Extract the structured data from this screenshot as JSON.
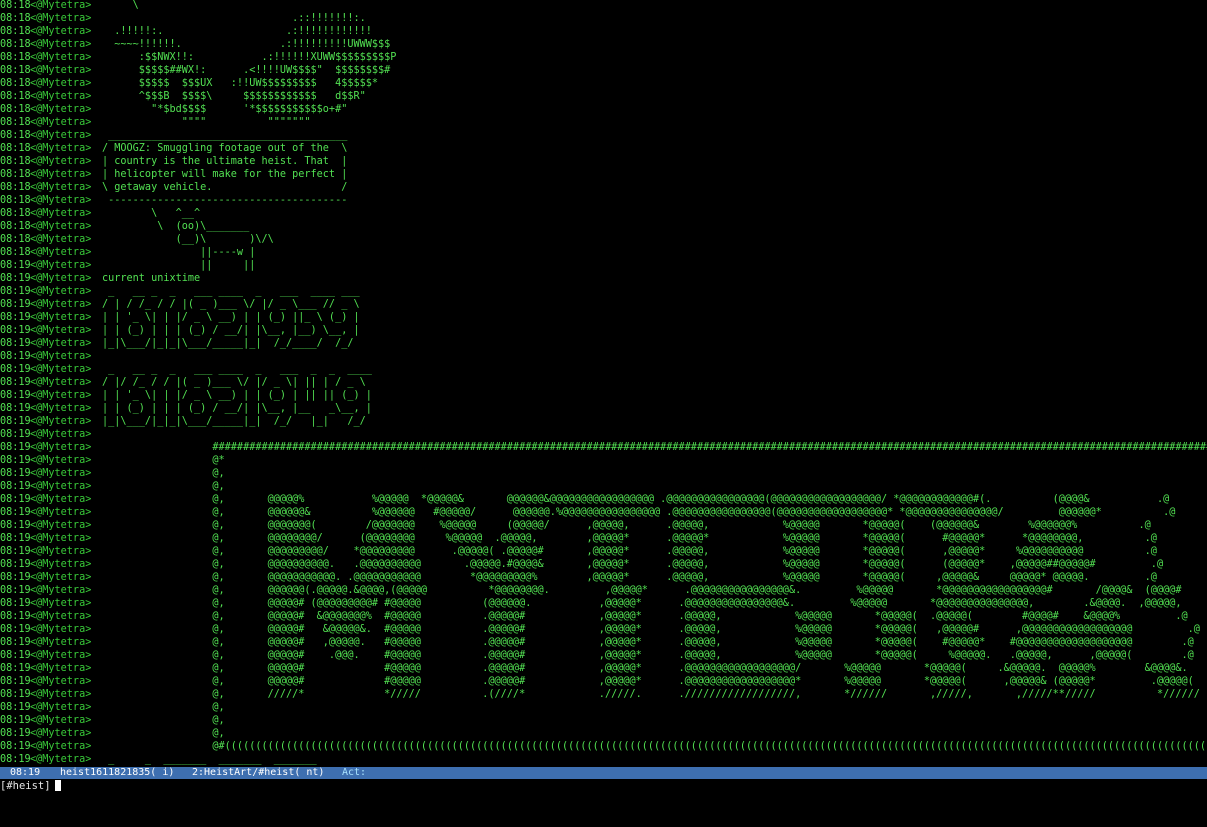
{
  "channel_log": {
    "nick": "<@Mytetra>",
    "lines": [
      {
        "time": "08:18",
        "text": "     \\"
      },
      {
        "time": "08:18",
        "text": "                               .::!!!!!!!:."
      },
      {
        "time": "08:18",
        "text": "  .!!!!!:.                    .:!!!!!!!!!!!!"
      },
      {
        "time": "08:18",
        "text": "  ~~~~!!!!!!.                .:!!!!!!!!!UWWW$$$"
      },
      {
        "time": "08:18",
        "text": "      :$$NWX!!:           .:!!!!!!XUWW$$$$$$$$$P"
      },
      {
        "time": "08:18",
        "text": "      $$$$$##WX!:      .<!!!!UW$$$$\"  $$$$$$$$#"
      },
      {
        "time": "08:18",
        "text": "      $$$$$  $$$UX   :!!UW$$$$$$$$$   4$$$$$*"
      },
      {
        "time": "08:18",
        "text": "      ^$$$B  $$$$\\     $$$$$$$$$$$$   d$$R\""
      },
      {
        "time": "08:18",
        "text": "        \"*$bd$$$$      '*$$$$$$$$$$$o+#\""
      },
      {
        "time": "08:18",
        "text": "             \"\"\"\"          \"\"\"\"\"\"\""
      },
      {
        "time": "08:18",
        "text": " _______________________________________"
      },
      {
        "time": "08:18",
        "text": "/ MOOGZ: Smuggling footage out of the  \\"
      },
      {
        "time": "08:18",
        "text": "| country is the ultimate heist. That  |"
      },
      {
        "time": "08:18",
        "text": "| helicopter will make for the perfect |"
      },
      {
        "time": "08:18",
        "text": "\\ getaway vehicle.                     /"
      },
      {
        "time": "08:18",
        "text": " ---------------------------------------"
      },
      {
        "time": "08:18",
        "text": "        \\   ^__^"
      },
      {
        "time": "08:18",
        "text": "         \\  (oo)\\_______"
      },
      {
        "time": "08:18",
        "text": "            (__)\\       )\\/\\"
      },
      {
        "time": "08:18",
        "text": "                ||----w |"
      },
      {
        "time": "08:19",
        "text": "                ||     ||"
      },
      {
        "time": "08:19",
        "text": "current unixtime"
      },
      {
        "time": "08:19",
        "text": " _   __ _  _   ___ ____  _   ___  ____ ___"
      },
      {
        "time": "08:19",
        "text": "/ | / /_ / / |( _ )___ \\/ |/ _ \\___ // _ \\"
      },
      {
        "time": "08:19",
        "text": "| | '_ \\| | |/ _ \\ __) | | (_) ||_ \\ (_) |"
      },
      {
        "time": "08:19",
        "text": "| | (_) | | | (_) / __/| |\\__, |__) \\__, |"
      },
      {
        "time": "08:19",
        "text": "|_|\\___/|_|_|\\___/_____|_|  /_/____/  /_/"
      },
      {
        "time": "08:19",
        "text": ""
      },
      {
        "time": "08:19",
        "text": " _   __ _  _   ___ ____  _   ___  _  _  ____"
      },
      {
        "time": "08:19",
        "text": "/ |/ /_ / / |( _ )___ \\/ |/ _ \\| || | / _ \\"
      },
      {
        "time": "08:19",
        "text": "| | '_ \\| | |/ _ \\ __) | | (_) | || || (_) |"
      },
      {
        "time": "08:19",
        "text": "| | (_) | | | (_) / __/| |\\__, |__   _\\__, |"
      },
      {
        "time": "08:19",
        "text": "|_|\\___/|_|_|\\___/_____|_|  /_/   |_|   /_/"
      },
      {
        "time": "08:19",
        "text": ""
      },
      {
        "time": "08:19",
        "text": "                  ##########################################################################################################################################################################"
      },
      {
        "time": "08:19",
        "text": "                  @*                                                                                                                                                                      .@"
      },
      {
        "time": "08:19",
        "text": "                  @,                                                                                                                                                                      .@"
      },
      {
        "time": "08:19",
        "text": "                  @,                                                                                                                                                                      .@"
      },
      {
        "time": "08:19",
        "text": "                  @,       @@@@@%           %@@@@@  *@@@@@&       @@@@@@&@@@@@@@@@@@@@@@@@ .@@@@@@@@@@@@@@@@(@@@@@@@@@@@@@@@@@@/ *@@@@@@@@@@@@#(.          (@@@@&           .@"
      },
      {
        "time": "08:19",
        "text": "                  @,       @@@@@@&          %@@@@@@   #@@@@@/      @@@@@@.%@@@@@@@@@@@@@@@@ .@@@@@@@@@@@@@@@@(@@@@@@@@@@@@@@@@@@* *@@@@@@@@@@@@@@@/         @@@@@@*          .@"
      },
      {
        "time": "08:19",
        "text": "                  @,       @@@@@@@(        /@@@@@@@    %@@@@@     (@@@@@/      ,@@@@@,      .@@@@@,            %@@@@@       *@@@@@(    (@@@@@@&        %@@@@@@%          .@"
      },
      {
        "time": "08:19",
        "text": "                  @,       @@@@@@@@/      (@@@@@@@@     %@@@@@  .@@@@@,        ,@@@@@*      .@@@@@*            %@@@@@       *@@@@@(      #@@@@@*      *@@@@@@@@,          .@"
      },
      {
        "time": "08:19",
        "text": "                  @,       @@@@@@@@@/    *@@@@@@@@@      .@@@@@( .@@@@@#       ,@@@@@*      .@@@@@,            %@@@@@       *@@@@@(      ,@@@@@*     %@@@@@@@@@@          .@"
      },
      {
        "time": "08:19",
        "text": "                  @,       @@@@@@@@@@.   .@@@@@@@@@@       .@@@@@.#@@@@&       ,@@@@@*      .@@@@@,            %@@@@@       *@@@@@(      (@@@@@*    ,@@@@@##@@@@@#         .@"
      },
      {
        "time": "08:19",
        "text": "                  @,       @@@@@@@@@@@. .@@@@@@@@@@@        *@@@@@@@@@%        ,@@@@@*      .@@@@@,            %@@@@@       *@@@@@(     ,@@@@@&     @@@@@* @@@@@.         .@"
      },
      {
        "time": "08:19",
        "text": "                  @,       @@@@@@(.@@@@@.&@@@@,(@@@@@          *@@@@@@@@.         ,@@@@@*      .@@@@@@@@@@@@@@@@&.         %@@@@@       *@@@@@@@@@@@@@@@@@#       /@@@@&  (@@@@#         .@"
      },
      {
        "time": "08:19",
        "text": "                  @,       @@@@@# (@@@@@@@@@# #@@@@@          (@@@@@@.           ,@@@@@*      .@@@@@@@@@@@@@@@@&.         %@@@@@       *@@@@@@@@@@@@@@@,        .&@@@@.  ,@@@@@,         .@"
      },
      {
        "time": "08:19",
        "text": "                  @,       @@@@@#  &@@@@@@@%  #@@@@@          .@@@@@#            ,@@@@@*      .@@@@@,            %@@@@@       *@@@@@(  .@@@@@(        #@@@@#    &@@@@%         .@"
      },
      {
        "time": "08:19",
        "text": "                  @,       @@@@@#   &@@@@@&.  #@@@@@          .@@@@@#            ,@@@@@*      .@@@@@,            %@@@@@       *@@@@@(   ,@@@@@#      ,@@@@@@@@@@@@@@@@@@         .@"
      },
      {
        "time": "08:19",
        "text": "                  @,       @@@@@#   ,@@@@@.   #@@@@@          .@@@@@#            ,@@@@@*      .@@@@@,            %@@@@@       *@@@@@(    #@@@@@*    #@@@@@@@@@@@@@@@@@@@        .@"
      },
      {
        "time": "08:19",
        "text": "                  @,       @@@@@#    .@@@.    #@@@@@          .@@@@@#            ,@@@@@*      .@@@@@,            %@@@@@       *@@@@@(     %@@@@@.   .@@@@@,      ,@@@@@(        .@"
      },
      {
        "time": "08:19",
        "text": "                  @,       @@@@@#             #@@@@@          .@@@@@#            ,@@@@@*      .@@@@@@@@@@@@@@@@@@/       %@@@@@       *@@@@@(     .&@@@@@.  @@@@@%        &@@@@&.       .@"
      },
      {
        "time": "08:19",
        "text": "                  @,       @@@@@#             #@@@@@          .@@@@@#            ,@@@@@*      .@@@@@@@@@@@@@@@@@@*       %@@@@@       *@@@@@(      ,@@@@@& (@@@@@*         .@@@@@(       .@"
      },
      {
        "time": "08:19",
        "text": "                  @,       /////*             */////          .(////*            ./////.      .//////////////////,       *//////       ,/////,       ,/////**/////          *//////       .@"
      },
      {
        "time": "08:19",
        "text": "                  @,                                                                                                                                                                      .@"
      },
      {
        "time": "08:19",
        "text": "                  @,                                                                                                                                                                      .@"
      },
      {
        "time": "08:19",
        "text": "                  @,                                                                                                                                                                      .@"
      },
      {
        "time": "08:19",
        "text": "                  @#((((((((((((((((((((((((((((((((((((((((((((((((((((((((((((((((((((((((((((((((((((((((((((((((((((((((((((((((((((((((((((((((((((((((((((((((((((((((((((((((((((((((((((((((#@"
      },
      {
        "time": "08:19",
        "text": " _     _  _______  _______  _______"
      }
    ]
  },
  "status_bar": {
    "time": "08:19",
    "nick_mode": "heist1611821835( i)",
    "window": "2:HeistArt/#heist( nt)",
    "activity_label": "Act:",
    "bg_color": "#3e6fb0"
  },
  "input_line": {
    "prompt": "[#heist]",
    "value": ""
  },
  "colors": {
    "background": "#000000",
    "text": "#52e052",
    "nick": "#39c939"
  }
}
